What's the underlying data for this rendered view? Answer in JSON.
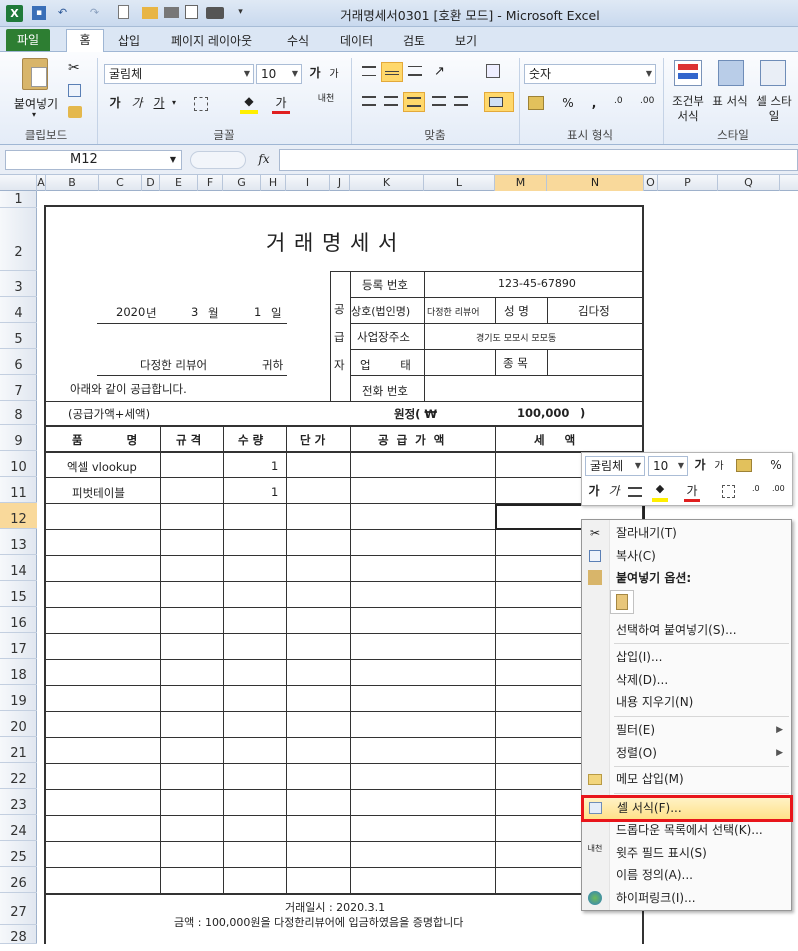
{
  "window": {
    "title": "거래명세서0301  [호환 모드]  -  Microsoft Excel"
  },
  "qat": {
    "undo": "↶",
    "redo": "↷"
  },
  "ribbon": {
    "tabs": [
      "파일",
      "홈",
      "삽입",
      "페이지 레이아웃",
      "수식",
      "데이터",
      "검토",
      "보기"
    ],
    "clipboard": {
      "paste_label": "붙여넣기",
      "group": "클립보드"
    },
    "font": {
      "name": "굴림체",
      "size": "10",
      "group": "글꼴",
      "bold": "가",
      "italic": "가",
      "underline": "가",
      "grow": "가",
      "shrink": "가",
      "fontcolor": "가",
      "phonetic": "내천"
    },
    "alignment": {
      "group": "맞춤"
    },
    "number": {
      "format": "숫자",
      "group": "표시 형식",
      "percent": "%",
      "comma": ","
    },
    "styles": {
      "group": "스타일",
      "cond": "조건부 서식",
      "table": "표 서식",
      "cell": "셀 스타일"
    }
  },
  "formula_bar": {
    "namebox": "M12",
    "fx": "fx",
    "value": ""
  },
  "columns": [
    "A",
    "B",
    "C",
    "D",
    "E",
    "F",
    "G",
    "H",
    "I",
    "J",
    "K",
    "L",
    "M",
    "N",
    "O",
    "P",
    "Q"
  ],
  "rows": [
    "1",
    "2",
    "3",
    "4",
    "5",
    "6",
    "7",
    "8",
    "9",
    "10",
    "11",
    "12",
    "13",
    "14",
    "15",
    "16",
    "17",
    "18",
    "19",
    "20",
    "21",
    "22",
    "23",
    "24",
    "25",
    "26",
    "27",
    "28"
  ],
  "invoice": {
    "title": "거 래 명 세 서",
    "year": "2020",
    "year_unit": "년",
    "month": "3",
    "month_unit": "월",
    "day": "1",
    "day_unit": "일",
    "recipient": "다정한 리뷰어",
    "honorific": "귀하",
    "supply_note": "아래와 같이 공급합니다.",
    "supplier_vertical": [
      "공",
      "급",
      "자"
    ],
    "reg_no_label": "등록 번호",
    "reg_no": "123-45-67890",
    "company_label": "상호(법인명)",
    "company": "다정한 리뷰어",
    "name_label": "성 명",
    "name": "김다정",
    "address_label": "사업장주소",
    "address": "경기도 모모시 모모동",
    "biz_type_label": "업 태",
    "biz_item_label": "종 목",
    "phone_label": "전화 번호",
    "total_note": "(공급가액+세액)",
    "total_label": "원정( ₩",
    "total_value": "100,000",
    "total_close": ")",
    "headers": {
      "item": "품  명",
      "spec": "규 격",
      "qty": "수 량",
      "price": "단 가",
      "supply": "공  급  가  액",
      "tax": "세     액"
    },
    "items": [
      {
        "name": "엑셀 vlookup",
        "qty": "1"
      },
      {
        "name": "피벗테이블",
        "qty": "1"
      }
    ],
    "footer_date": "거래일시 : 2020.3.1",
    "footer_amount": "금액 : 100,000원을 다정한리뷰어에 입금하였음을 증명합니다"
  },
  "mini_toolbar": {
    "font": "굴림체",
    "size": "10",
    "percent": "%"
  },
  "context_menu": {
    "cut": "잘라내기(T)",
    "copy": "복사(C)",
    "paste_options": "붙여넣기 옵션:",
    "paste_special": "선택하여 붙여넣기(S)...",
    "insert": "삽입(I)...",
    "delete": "삭제(D)...",
    "clear": "내용 지우기(N)",
    "filter": "필터(E)",
    "sort": "정렬(O)",
    "insert_comment": "메모 삽입(M)",
    "format_cells": "셀 서식(F)...",
    "pick_list": "드롭다운 목록에서 선택(K)...",
    "phonetic": "윗주 필드 표시(S)",
    "define_name": "이름 정의(A)...",
    "hyperlink": "하이퍼링크(I)..."
  }
}
